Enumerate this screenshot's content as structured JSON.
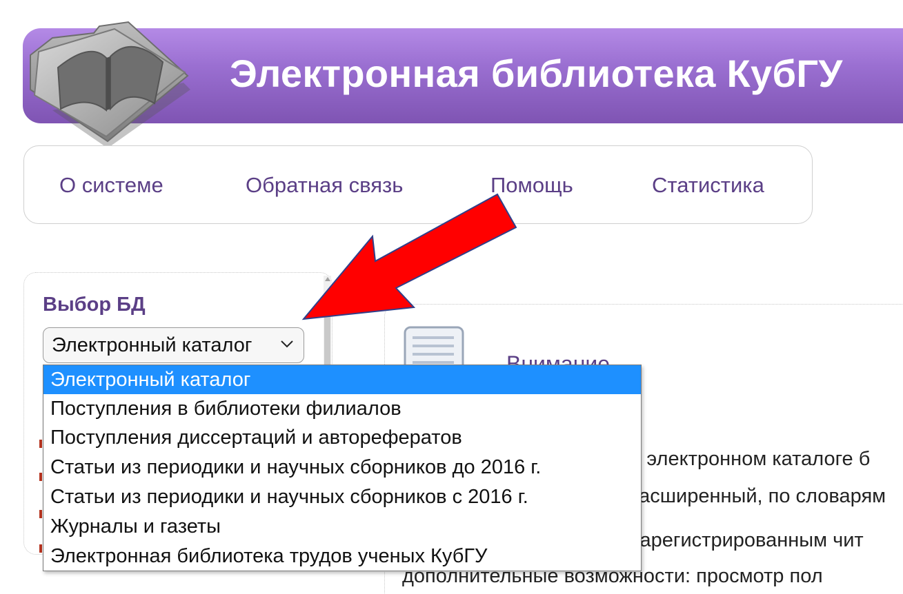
{
  "header": {
    "title": "Электронная библиотека КубГУ",
    "logo_icon": "open-book-folder-icon",
    "gradient": [
      "#b48ae6",
      "#7f54b3"
    ]
  },
  "nav": {
    "items": [
      {
        "label": "О системе"
      },
      {
        "label": "Обратная связь"
      },
      {
        "label": "Помощь"
      },
      {
        "label": "Статистика"
      }
    ],
    "link_color": "#5b3f86"
  },
  "sidebar": {
    "section_title": "Выбор БД",
    "select": {
      "value": "Электронный каталог",
      "chevron_icon": "chevron-down-icon",
      "options": [
        {
          "label": "Электронный каталог",
          "selected": true
        },
        {
          "label": "Поступления в библиотеки филиалов",
          "selected": false
        },
        {
          "label": "Поступления диссертаций и авторефератов",
          "selected": false
        },
        {
          "label": "Статьи из периодики и научных сборников до 2016 г.",
          "selected": false
        },
        {
          "label": "Статьи из периодики и научных сборников с 2016 г.",
          "selected": false
        },
        {
          "label": "Журналы и газеты",
          "selected": false
        },
        {
          "label": "Электронная библиотека трудов ученых КубГУ",
          "selected": false
        }
      ]
    }
  },
  "main": {
    "attention_title": "Внимание",
    "lines": [
      "В электронном каталоге б",
      "расширенный, по словарям",
      "Зарегистрированным чит",
      "дополнительные возможности: просмотр пол"
    ]
  },
  "annotation": {
    "arrow_color": "#ff0000"
  },
  "colors": {
    "selected_option_bg": "#1e90ff",
    "accent": "#5b3f86"
  }
}
